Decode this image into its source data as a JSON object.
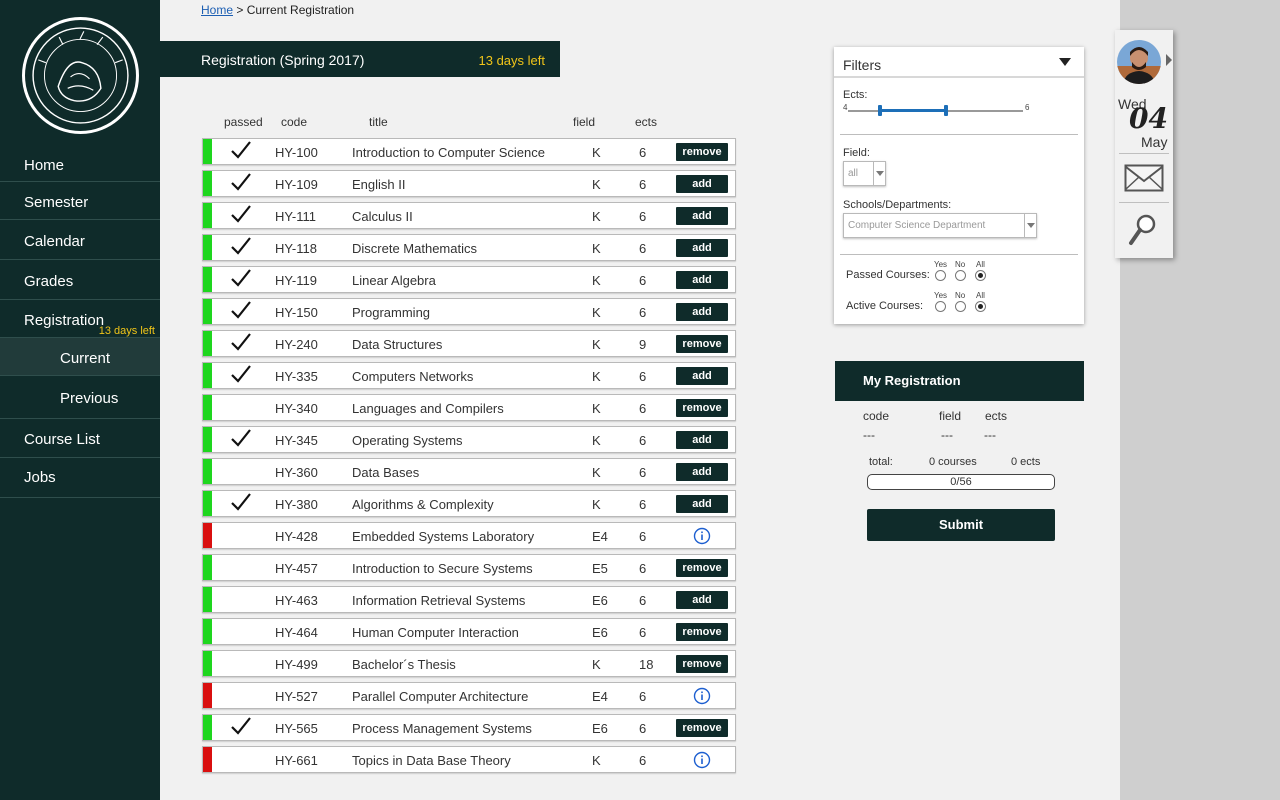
{
  "breadcrumb": {
    "home": "Home",
    "sep": " > ",
    "current": "Current Registration"
  },
  "header": {
    "title": "Registration (Spring 2017)",
    "days_left": "13 days left"
  },
  "sidebar": {
    "items": [
      {
        "label": "Home"
      },
      {
        "label": "Semester"
      },
      {
        "label": "Calendar"
      },
      {
        "label": "Grades"
      },
      {
        "label": "Registration",
        "badge": "13 days left"
      },
      {
        "label": "Current"
      },
      {
        "label": "Previous"
      },
      {
        "label": "Course List"
      },
      {
        "label": "Jobs"
      }
    ]
  },
  "columns": {
    "passed": "passed",
    "code": "code",
    "title": "title",
    "field": "field",
    "ects": "ects"
  },
  "courses": [
    {
      "code": "HY-100",
      "title": "Introduction to Computer Science",
      "field": "K",
      "ects": "6",
      "passed": true,
      "status": "green",
      "action": "remove"
    },
    {
      "code": "HY-109",
      "title": "English II",
      "field": "K",
      "ects": "6",
      "passed": true,
      "status": "green",
      "action": "add"
    },
    {
      "code": "HY-111",
      "title": "Calculus II",
      "field": "K",
      "ects": "6",
      "passed": true,
      "status": "green",
      "action": "add"
    },
    {
      "code": "HY-118",
      "title": "Discrete Mathematics",
      "field": "K",
      "ects": "6",
      "passed": true,
      "status": "green",
      "action": "add"
    },
    {
      "code": "HY-119",
      "title": "Linear Algebra",
      "field": "K",
      "ects": "6",
      "passed": true,
      "status": "green",
      "action": "add"
    },
    {
      "code": "HY-150",
      "title": "Programming",
      "field": "K",
      "ects": "6",
      "passed": true,
      "status": "green",
      "action": "add"
    },
    {
      "code": "HY-240",
      "title": "Data Structures",
      "field": "K",
      "ects": "9",
      "passed": true,
      "status": "green",
      "action": "remove"
    },
    {
      "code": "HY-335",
      "title": "Computers Networks",
      "field": "K",
      "ects": "6",
      "passed": true,
      "status": "green",
      "action": "add"
    },
    {
      "code": "HY-340",
      "title": "Languages and Compilers",
      "field": "K",
      "ects": "6",
      "passed": false,
      "status": "green",
      "action": "remove"
    },
    {
      "code": "HY-345",
      "title": "Operating Systems",
      "field": "K",
      "ects": "6",
      "passed": true,
      "status": "green",
      "action": "add"
    },
    {
      "code": "HY-360",
      "title": "Data Bases",
      "field": "K",
      "ects": "6",
      "passed": false,
      "status": "green",
      "action": "add"
    },
    {
      "code": "HY-380",
      "title": "Algorithms & Complexity",
      "field": "K",
      "ects": "6",
      "passed": true,
      "status": "green",
      "action": "add"
    },
    {
      "code": "HY-428",
      "title": "Embedded Systems Laboratory",
      "field": "E4",
      "ects": "6",
      "passed": false,
      "status": "red",
      "action": "info"
    },
    {
      "code": "HY-457",
      "title": "Introduction to Secure Systems",
      "field": "E5",
      "ects": "6",
      "passed": false,
      "status": "green",
      "action": "remove"
    },
    {
      "code": "HY-463",
      "title": "Information Retrieval Systems",
      "field": "E6",
      "ects": "6",
      "passed": false,
      "status": "green",
      "action": "add"
    },
    {
      "code": "HY-464",
      "title": "Human Computer Interaction",
      "field": "E6",
      "ects": "6",
      "passed": false,
      "status": "green",
      "action": "remove"
    },
    {
      "code": "HY-499",
      "title": "Bachelor´s Thesis",
      "field": "K",
      "ects": "18",
      "passed": false,
      "status": "green",
      "action": "remove"
    },
    {
      "code": "HY-527",
      "title": "Parallel Computer Architecture",
      "field": "E4",
      "ects": "6",
      "passed": false,
      "status": "red",
      "action": "info"
    },
    {
      "code": "HY-565",
      "title": "Process Management Systems",
      "field": "E6",
      "ects": "6",
      "passed": true,
      "status": "green",
      "action": "remove"
    },
    {
      "code": "HY-661",
      "title": "Topics in Data Base Theory",
      "field": "K",
      "ects": "6",
      "passed": false,
      "status": "red",
      "action": "info"
    }
  ],
  "filters": {
    "title": "Filters",
    "ects_label": "Ects:",
    "ects_min": "4",
    "ects_max": "6",
    "field_label": "Field:",
    "field_value": "all",
    "schools_label": "Schools/Departments:",
    "schools_value": "Computer Science Department",
    "passed_label": "Passed Courses:",
    "active_label": "Active Courses:",
    "opt_yes": "Yes",
    "opt_no": "No",
    "opt_all": "All"
  },
  "my_registration": {
    "title": "My Registration",
    "col_code": "code",
    "col_field": "field",
    "col_ects": "ects",
    "empty": "---",
    "total_label": "total:",
    "total_courses": "0 courses",
    "total_ects": "0 ects",
    "progress": "0/56",
    "submit": "Submit"
  },
  "date": {
    "dow": "Wed",
    "day": "04",
    "month": "May"
  },
  "colors": {
    "dark": "#0f2b2a",
    "accent_yellow": "#f0c419",
    "green": "#1ed61e",
    "red": "#d90f0f",
    "link": "#1d5fb3"
  }
}
